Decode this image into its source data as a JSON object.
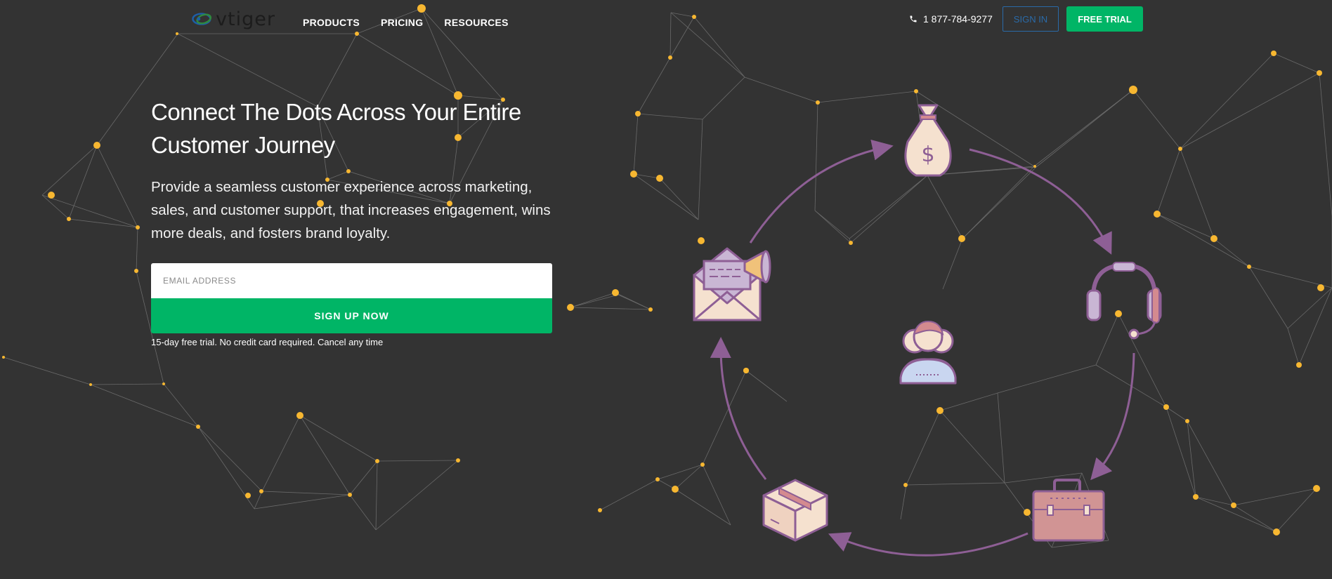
{
  "nav": {
    "logo_text": "vtiger",
    "menu": [
      {
        "label": "PRODUCTS"
      },
      {
        "label": "PRICING"
      },
      {
        "label": "RESOURCES"
      }
    ],
    "phone": "1 877-784-9277",
    "sign_in": "SIGN IN",
    "free_trial": "FREE TRIAL"
  },
  "hero": {
    "title": "Connect The Dots Across Your Entire Customer Journey",
    "subtitle": "Provide a seamless customer experience across marketing, sales, and customer support, that increases engagement, wins more deals, and fosters brand loyalty.",
    "email_placeholder": "EMAIL ADDRESS",
    "signup_button": "SIGN UP NOW",
    "disclaimer": "15-day free trial. No credit card required. Cancel any time"
  },
  "colors": {
    "background": "#333333",
    "accent_green": "#00b566",
    "sign_in_blue": "#2a6aa8",
    "network_dot": "#f7b731",
    "network_line": "#6a6a6a",
    "cycle_arrow": "#8e5f95"
  },
  "icons": {
    "cycle": [
      "money-bag-icon",
      "headset-icon",
      "briefcase-icon",
      "package-box-icon",
      "email-megaphone-icon",
      "customers-group-icon"
    ],
    "nav": [
      "phone-icon"
    ]
  }
}
